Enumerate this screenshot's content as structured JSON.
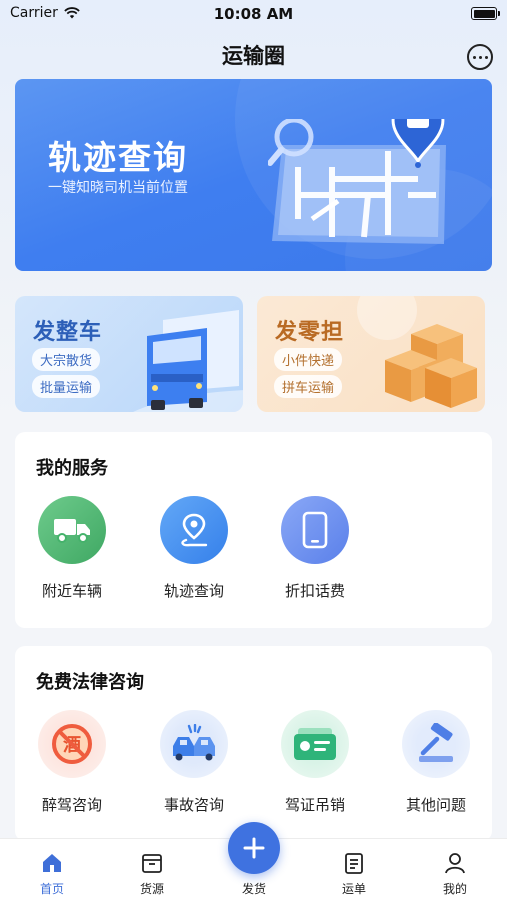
{
  "status": {
    "carrier": "Carrier",
    "time": "10:08 AM"
  },
  "header": {
    "title": "运输圈",
    "chat_icon": "chat-bubble-icon"
  },
  "banner": {
    "title": "轨迹查询",
    "subtitle": "一键知晓司机当前位置",
    "accent": "#3f7ef0"
  },
  "cards": [
    {
      "title": "发整车",
      "tags": [
        "大宗散货",
        "批量运输"
      ],
      "icon": "truck-icon",
      "accent": "#2c5fb8"
    },
    {
      "title": "发零担",
      "tags": [
        "小件快递",
        "拼车运输"
      ],
      "icon": "boxes-icon",
      "accent": "#b96a23"
    }
  ],
  "services": {
    "title": "我的服务",
    "items": [
      {
        "label": "附近车辆",
        "icon": "truck-icon",
        "color": "#45b26b"
      },
      {
        "label": "轨迹查询",
        "icon": "location-pin-icon",
        "color": "#3d8ff0"
      },
      {
        "label": "折扣话费",
        "icon": "phone-icon",
        "color": "#5d86ee"
      }
    ]
  },
  "legal": {
    "title": "免费法律咨询",
    "items": [
      {
        "label": "醉驾咨询",
        "icon": "no-drinking-icon",
        "color": "#ef5c3e"
      },
      {
        "label": "事故咨询",
        "icon": "car-crash-icon",
        "color": "#3d7ee8"
      },
      {
        "label": "驾证吊销",
        "icon": "license-card-icon",
        "color": "#2fb47a"
      },
      {
        "label": "其他问题",
        "icon": "gavel-icon",
        "color": "#4e7ee6"
      }
    ]
  },
  "tabbar": {
    "items": [
      {
        "label": "首页",
        "icon": "home-icon",
        "active": true
      },
      {
        "label": "货源",
        "icon": "cargo-box-icon",
        "active": false
      },
      {
        "label": "发货",
        "icon": "plus-icon",
        "active": false
      },
      {
        "label": "运单",
        "icon": "waybill-icon",
        "active": false
      },
      {
        "label": "我的",
        "icon": "user-icon",
        "active": false
      }
    ],
    "accent": "#3f6fd8"
  }
}
